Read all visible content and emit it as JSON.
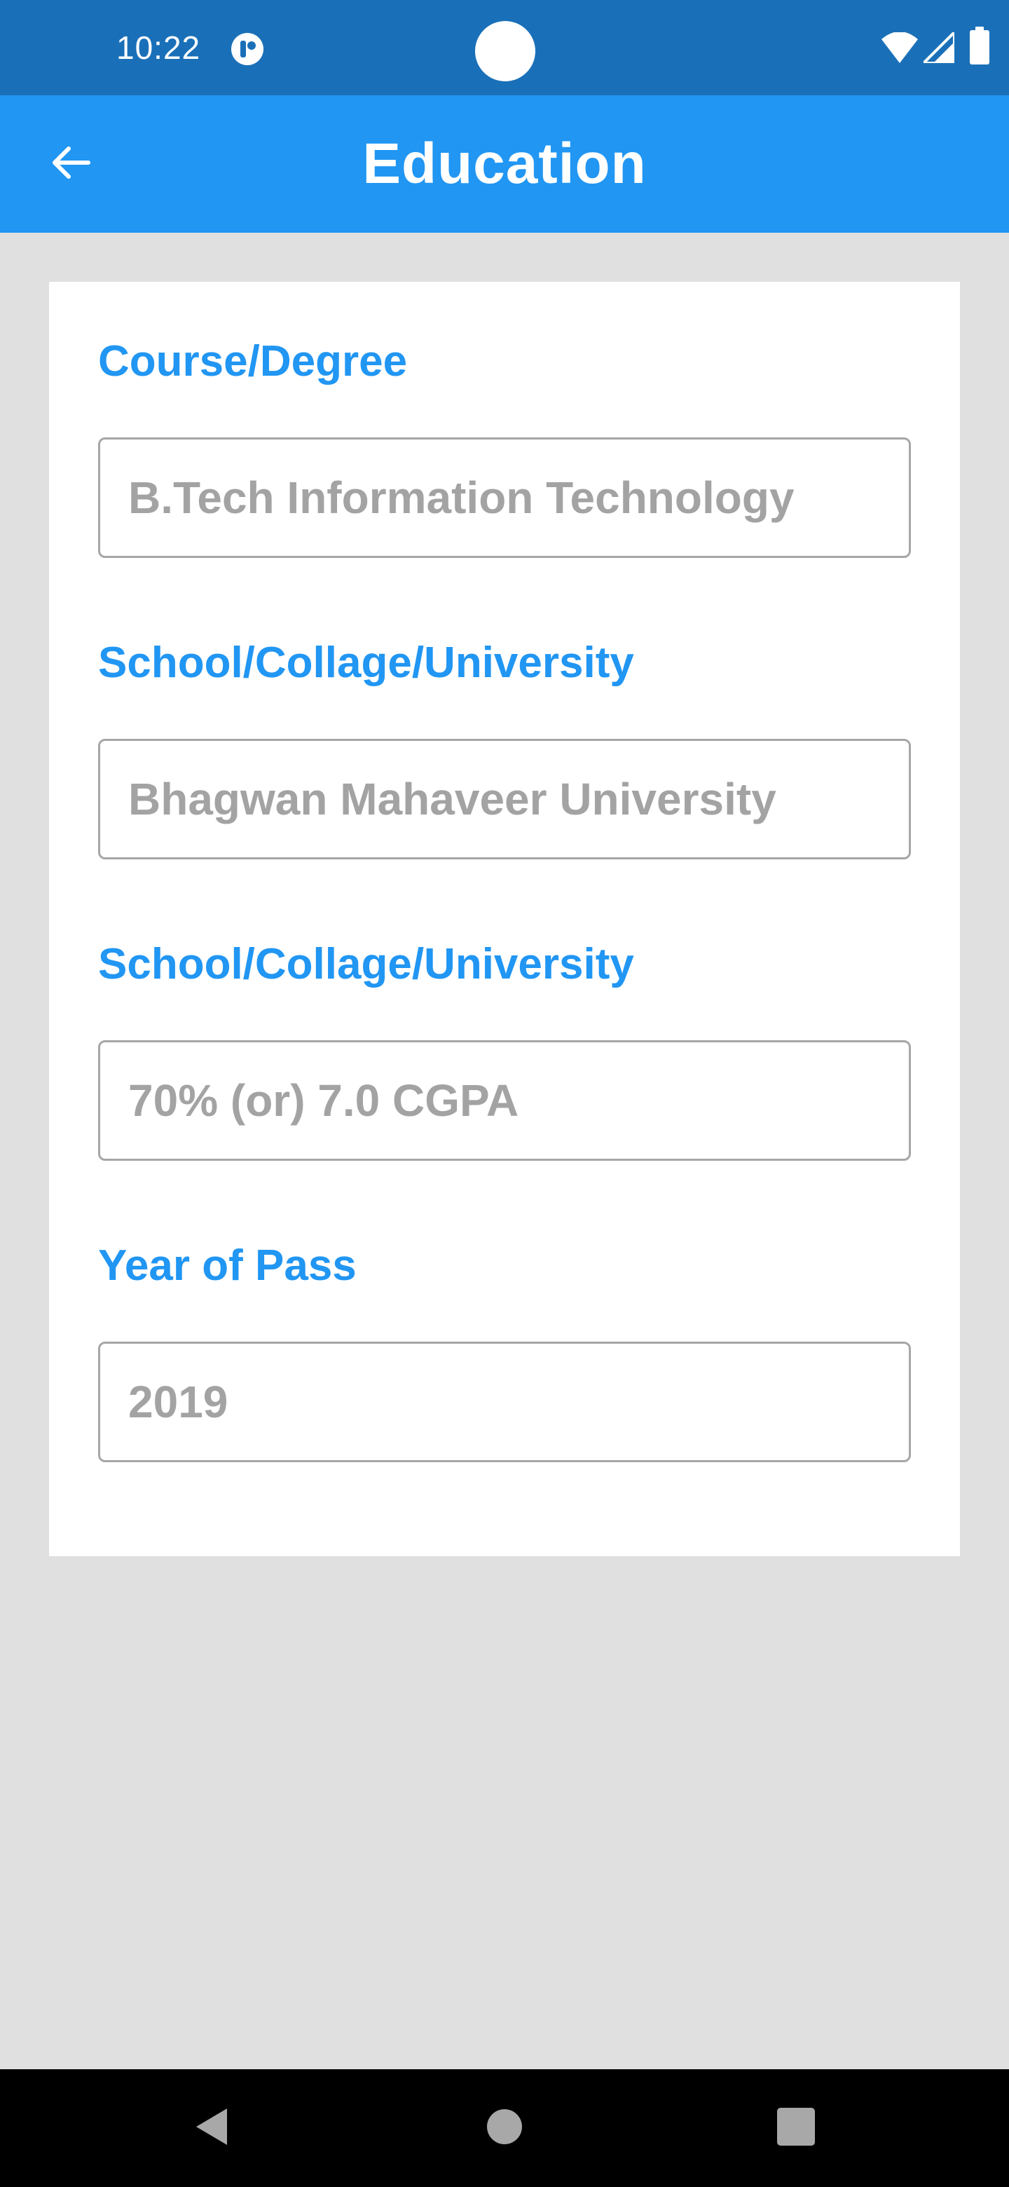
{
  "status_bar": {
    "time": "10:22"
  },
  "app_bar": {
    "title": "Education",
    "back_icon": "arrow-back-icon"
  },
  "form": {
    "fields": [
      {
        "label": "Course/Degree",
        "placeholder": "B.Tech Information Technology",
        "value": ""
      },
      {
        "label": "School/Collage/University",
        "placeholder": "Bhagwan Mahaveer University",
        "value": ""
      },
      {
        "label": "School/Collage/University",
        "placeholder": "70% (or) 7.0 CGPA",
        "value": ""
      },
      {
        "label": "Year of Pass",
        "placeholder": "2019",
        "value": ""
      }
    ]
  },
  "nav_bar": {
    "back_icon": "triangle-back-icon",
    "home_icon": "circle-home-icon",
    "recents_icon": "square-recents-icon"
  },
  "colors": {
    "status_bar": "#1a70b8",
    "app_bar": "#2196f3",
    "accent": "#2196f3",
    "background": "#e0e0e0",
    "card": "#ffffff",
    "input_border": "#a6a6a6",
    "placeholder": "#a3a3a3"
  }
}
